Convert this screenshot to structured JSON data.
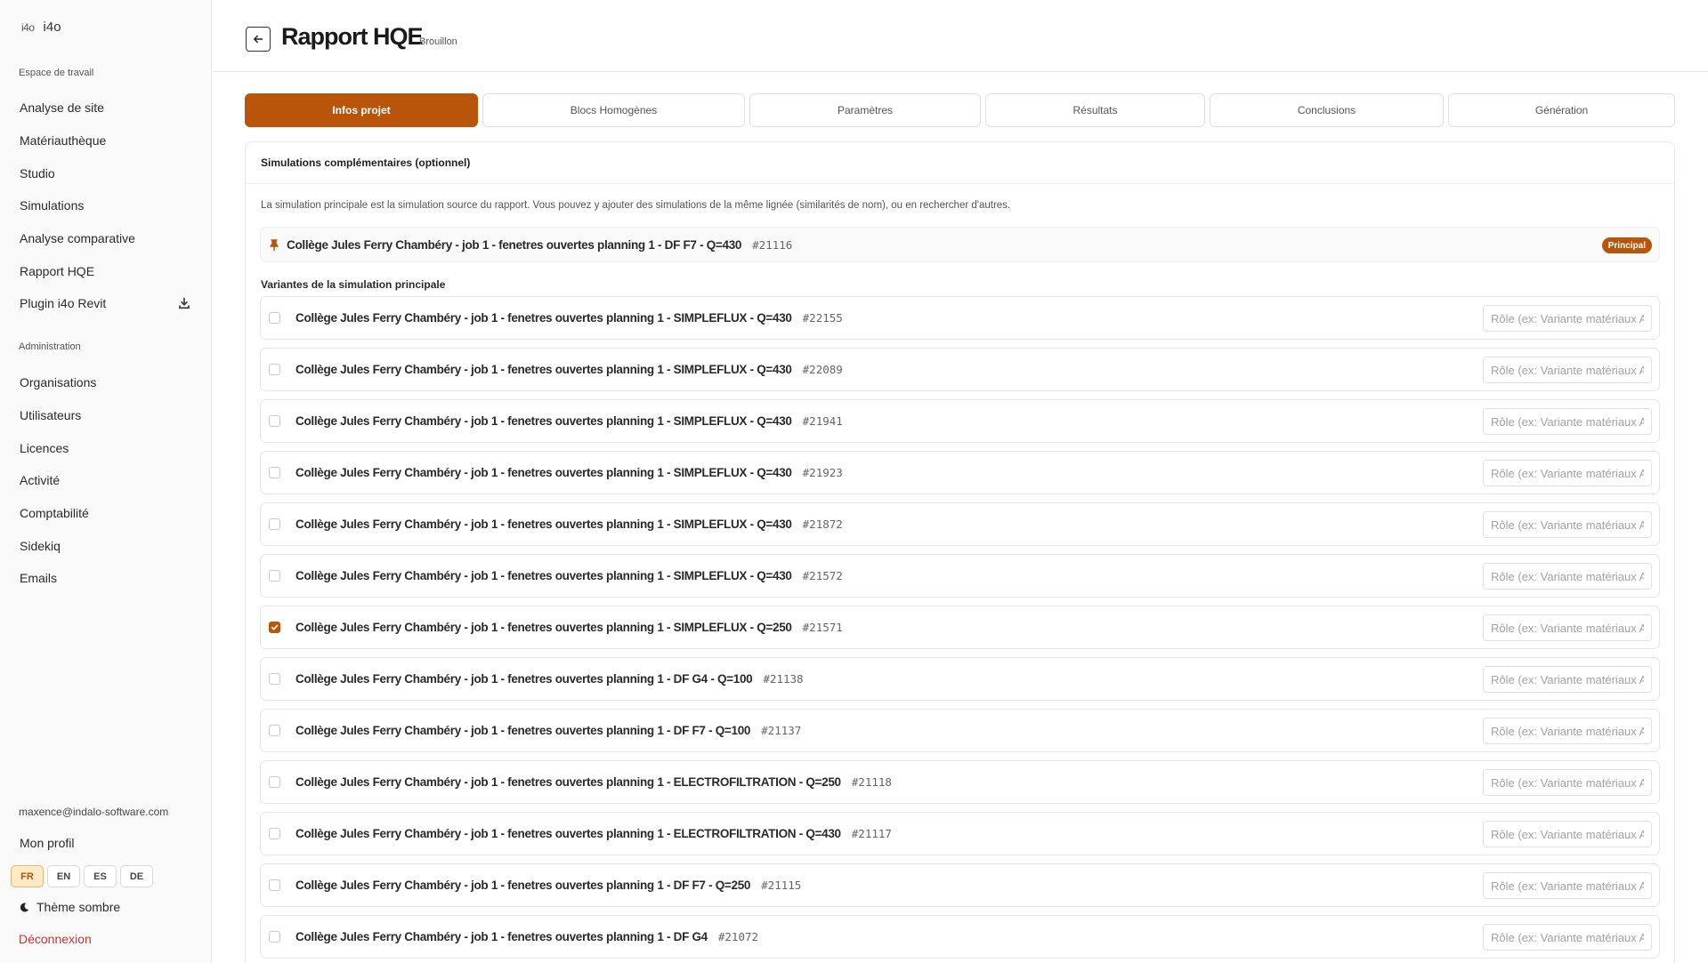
{
  "app": {
    "logo_mark": "i4o",
    "logo_text": "i4o"
  },
  "sidebar": {
    "workspace_label": "Espace de travail",
    "workspace_items": [
      {
        "label": "Analyse de site"
      },
      {
        "label": "Matériauthèque"
      },
      {
        "label": "Studio"
      },
      {
        "label": "Simulations"
      },
      {
        "label": "Analyse comparative"
      },
      {
        "label": "Rapport HQE"
      },
      {
        "label": "Plugin i4o Revit",
        "icon": "download-icon"
      }
    ],
    "admin_label": "Administration",
    "admin_items": [
      {
        "label": "Organisations"
      },
      {
        "label": "Utilisateurs"
      },
      {
        "label": "Licences"
      },
      {
        "label": "Activité"
      },
      {
        "label": "Comptabilité"
      },
      {
        "label": "Sidekiq"
      },
      {
        "label": "Emails"
      }
    ],
    "user_email": "maxence@indalo-software.com",
    "profile_label": "Mon profil",
    "languages": [
      "FR",
      "EN",
      "ES",
      "DE"
    ],
    "active_language": "FR",
    "theme_label": "Thème sombre",
    "logout_label": "Déconnexion"
  },
  "header": {
    "title": "Rapport HQE",
    "status": "Brouillon"
  },
  "tabs": [
    {
      "label": "Infos projet",
      "active": true
    },
    {
      "label": "Blocs Homogènes",
      "active": false
    },
    {
      "label": "Paramètres",
      "active": false
    },
    {
      "label": "Résultats",
      "active": false
    },
    {
      "label": "Conclusions",
      "active": false
    },
    {
      "label": "Génération",
      "active": false
    }
  ],
  "simulations": {
    "title": "Simulations complémentaires (optionnel)",
    "description": "La simulation principale est la simulation source du rapport. Vous pouvez y ajouter des simulations de la même lignée (similarités de nom), ou en rechercher d'autres.",
    "principal": {
      "name": "Collège Jules Ferry Chambéry - job 1 - fenetres ouvertes planning 1 - DF F7 - Q=430",
      "id": "#21116",
      "badge": "Principal"
    },
    "variants_label": "Variantes de la simulation principale",
    "role_placeholder": "Rôle (ex: Variante matériaux A",
    "variants": [
      {
        "name": "Collège Jules Ferry Chambéry - job 1 - fenetres ouvertes planning 1 - SIMPLEFLUX - Q=430",
        "id": "#22155",
        "checked": false
      },
      {
        "name": "Collège Jules Ferry Chambéry - job 1 - fenetres ouvertes planning 1 - SIMPLEFLUX - Q=430",
        "id": "#22089",
        "checked": false
      },
      {
        "name": "Collège Jules Ferry Chambéry - job 1 - fenetres ouvertes planning 1 - SIMPLEFLUX - Q=430",
        "id": "#21941",
        "checked": false
      },
      {
        "name": "Collège Jules Ferry Chambéry - job 1 - fenetres ouvertes planning 1 - SIMPLEFLUX - Q=430",
        "id": "#21923",
        "checked": false
      },
      {
        "name": "Collège Jules Ferry Chambéry - job 1 - fenetres ouvertes planning 1 - SIMPLEFLUX - Q=430",
        "id": "#21872",
        "checked": false
      },
      {
        "name": "Collège Jules Ferry Chambéry - job 1 - fenetres ouvertes planning 1 - SIMPLEFLUX - Q=430",
        "id": "#21572",
        "checked": false
      },
      {
        "name": "Collège Jules Ferry Chambéry - job 1 - fenetres ouvertes planning 1 - SIMPLEFLUX - Q=250",
        "id": "#21571",
        "checked": true
      },
      {
        "name": "Collège Jules Ferry Chambéry - job 1 - fenetres ouvertes planning 1 - DF G4 - Q=100",
        "id": "#21138",
        "checked": false
      },
      {
        "name": "Collège Jules Ferry Chambéry - job 1 - fenetres ouvertes planning 1 - DF F7 - Q=100",
        "id": "#21137",
        "checked": false
      },
      {
        "name": "Collège Jules Ferry Chambéry - job 1 - fenetres ouvertes planning 1 - ELECTROFILTRATION - Q=250",
        "id": "#21118",
        "checked": false
      },
      {
        "name": "Collège Jules Ferry Chambéry - job 1 - fenetres ouvertes planning 1 - ELECTROFILTRATION - Q=430",
        "id": "#21117",
        "checked": false
      },
      {
        "name": "Collège Jules Ferry Chambéry - job 1 - fenetres ouvertes planning 1 - DF F7 - Q=250",
        "id": "#21115",
        "checked": false
      },
      {
        "name": "Collège Jules Ferry Chambéry - job 1 - fenetres ouvertes planning 1 - DF G4",
        "id": "#21072",
        "checked": false
      }
    ]
  },
  "colors": {
    "accent": "#b8550a",
    "danger": "#d32f2f",
    "lang_active_bg": "#fdebc8"
  }
}
